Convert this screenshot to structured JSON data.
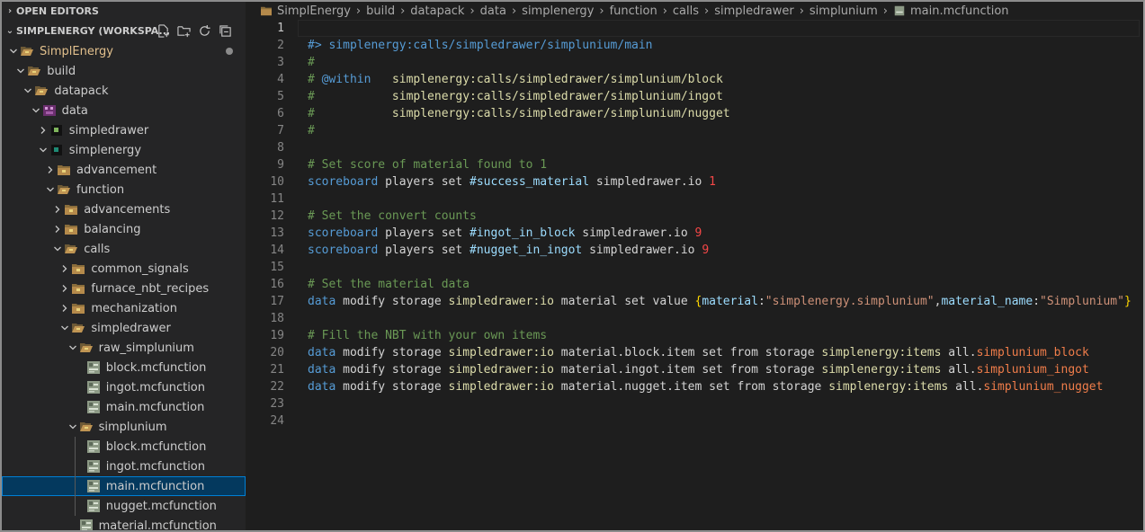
{
  "sidebar": {
    "open_editors_label": "OPEN EDITORS",
    "workspace_label": "SIMPLENERGY (WORKSPA...",
    "actions": [
      "new-file-icon",
      "new-folder-icon",
      "refresh-icon",
      "collapse-all-icon"
    ],
    "tree": [
      {
        "label": "SimplEnergy",
        "depth": 1,
        "kind": "folder-open",
        "color": "#e2c08d",
        "dirty": true
      },
      {
        "label": "build",
        "depth": 2,
        "kind": "folder-open"
      },
      {
        "label": "datapack",
        "depth": 3,
        "kind": "folder-open"
      },
      {
        "label": "data",
        "depth": 4,
        "kind": "data-open"
      },
      {
        "label": "simpledrawer",
        "depth": 5,
        "kind": "ns-closed"
      },
      {
        "label": "simplenergy",
        "depth": 5,
        "kind": "ns-open"
      },
      {
        "label": "advancement",
        "depth": 6,
        "kind": "folder-closed"
      },
      {
        "label": "function",
        "depth": 6,
        "kind": "folder-open"
      },
      {
        "label": "advancements",
        "depth": 7,
        "kind": "folder-closed"
      },
      {
        "label": "balancing",
        "depth": 7,
        "kind": "folder-closed"
      },
      {
        "label": "calls",
        "depth": 7,
        "kind": "folder-open"
      },
      {
        "label": "common_signals",
        "depth": 8,
        "kind": "folder-closed"
      },
      {
        "label": "furnace_nbt_recipes",
        "depth": 8,
        "kind": "folder-closed"
      },
      {
        "label": "mechanization",
        "depth": 8,
        "kind": "folder-closed"
      },
      {
        "label": "simpledrawer",
        "depth": 8,
        "kind": "folder-open"
      },
      {
        "label": "raw_simplunium",
        "depth": 9,
        "kind": "folder-open"
      },
      {
        "label": "block.mcfunction",
        "depth": 10,
        "kind": "file"
      },
      {
        "label": "ingot.mcfunction",
        "depth": 10,
        "kind": "file"
      },
      {
        "label": "main.mcfunction",
        "depth": 10,
        "kind": "file"
      },
      {
        "label": "simplunium",
        "depth": 9,
        "kind": "folder-open"
      },
      {
        "label": "block.mcfunction",
        "depth": 10,
        "kind": "file"
      },
      {
        "label": "ingot.mcfunction",
        "depth": 10,
        "kind": "file"
      },
      {
        "label": "main.mcfunction",
        "depth": 10,
        "kind": "file",
        "selected": true
      },
      {
        "label": "nugget.mcfunction",
        "depth": 10,
        "kind": "file"
      },
      {
        "label": "material.mcfunction",
        "depth": 9,
        "kind": "file"
      }
    ]
  },
  "breadcrumb": [
    "SimplEnergy",
    "build",
    "datapack",
    "data",
    "simplenergy",
    "function",
    "calls",
    "simpledrawer",
    "simplunium",
    "main.mcfunction"
  ],
  "editor": {
    "active_line": 1,
    "lines": [
      [],
      [
        [
          "#> simplenergy:calls/simpledrawer/simplunium/main",
          "#569cd6"
        ]
      ],
      [
        [
          "#",
          "#6a9955"
        ]
      ],
      [
        [
          "# ",
          "#6a9955"
        ],
        [
          "@within",
          "#569cd6"
        ],
        [
          "   ",
          "#6a9955"
        ],
        [
          "simplenergy:calls/simpledrawer/simplunium/block",
          "#dcdcaa"
        ]
      ],
      [
        [
          "#",
          "#6a9955"
        ],
        [
          "           ",
          "#6a9955"
        ],
        [
          "simplenergy:calls/simpledrawer/simplunium/ingot",
          "#dcdcaa"
        ]
      ],
      [
        [
          "#",
          "#6a9955"
        ],
        [
          "           ",
          "#6a9955"
        ],
        [
          "simplenergy:calls/simpledrawer/simplunium/nugget",
          "#dcdcaa"
        ]
      ],
      [
        [
          "#",
          "#6a9955"
        ]
      ],
      [],
      [
        [
          "# Set score of material found to 1",
          "#6a9955"
        ]
      ],
      [
        [
          "scoreboard",
          "#569cd6"
        ],
        [
          " players set ",
          "#d4d4d4"
        ],
        [
          "#success_material",
          "#9cdcfe"
        ],
        [
          " simpledrawer.io ",
          "#d4d4d4"
        ],
        [
          "1",
          "#f44747"
        ]
      ],
      [],
      [
        [
          "# Set the convert counts",
          "#6a9955"
        ]
      ],
      [
        [
          "scoreboard",
          "#569cd6"
        ],
        [
          " players set ",
          "#d4d4d4"
        ],
        [
          "#ingot_in_block",
          "#9cdcfe"
        ],
        [
          " simpledrawer.io ",
          "#d4d4d4"
        ],
        [
          "9",
          "#f44747"
        ]
      ],
      [
        [
          "scoreboard",
          "#569cd6"
        ],
        [
          " players set ",
          "#d4d4d4"
        ],
        [
          "#nugget_in_ingot",
          "#9cdcfe"
        ],
        [
          " simpledrawer.io ",
          "#d4d4d4"
        ],
        [
          "9",
          "#f44747"
        ]
      ],
      [],
      [
        [
          "# Set the material data",
          "#6a9955"
        ]
      ],
      [
        [
          "data",
          "#569cd6"
        ],
        [
          " modify storage ",
          "#d4d4d4"
        ],
        [
          "simpledrawer:io",
          "#dcdcaa"
        ],
        [
          " material set value ",
          "#d4d4d4"
        ],
        [
          "{",
          "#ffd700"
        ],
        [
          "material",
          "#9cdcfe"
        ],
        [
          ":",
          "#d4d4d4"
        ],
        [
          "\"simplenergy.simplunium\"",
          "#ce9178"
        ],
        [
          ",",
          "#d4d4d4"
        ],
        [
          "material_name",
          "#9cdcfe"
        ],
        [
          ":",
          "#d4d4d4"
        ],
        [
          "\"Simplunium\"",
          "#ce9178"
        ],
        [
          "}",
          "#ffd700"
        ]
      ],
      [],
      [
        [
          "# Fill the NBT with your own items",
          "#6a9955"
        ]
      ],
      [
        [
          "data",
          "#569cd6"
        ],
        [
          " modify storage ",
          "#d4d4d4"
        ],
        [
          "simpledrawer:io",
          "#dcdcaa"
        ],
        [
          " material.block.item set from storage ",
          "#d4d4d4"
        ],
        [
          "simplenergy:items",
          "#dcdcaa"
        ],
        [
          " all.",
          "#d4d4d4"
        ],
        [
          "simplunium_block",
          "#f07d4a"
        ]
      ],
      [
        [
          "data",
          "#569cd6"
        ],
        [
          " modify storage ",
          "#d4d4d4"
        ],
        [
          "simpledrawer:io",
          "#dcdcaa"
        ],
        [
          " material.ingot.item set from storage ",
          "#d4d4d4"
        ],
        [
          "simplenergy:items",
          "#dcdcaa"
        ],
        [
          " all.",
          "#d4d4d4"
        ],
        [
          "simplunium_ingot",
          "#f07d4a"
        ]
      ],
      [
        [
          "data",
          "#569cd6"
        ],
        [
          " modify storage ",
          "#d4d4d4"
        ],
        [
          "simpledrawer:io",
          "#dcdcaa"
        ],
        [
          " material.nugget.item set from storage ",
          "#d4d4d4"
        ],
        [
          "simplenergy:items",
          "#dcdcaa"
        ],
        [
          " all.",
          "#d4d4d4"
        ],
        [
          "simplunium_nugget",
          "#f07d4a"
        ]
      ],
      [],
      []
    ]
  }
}
